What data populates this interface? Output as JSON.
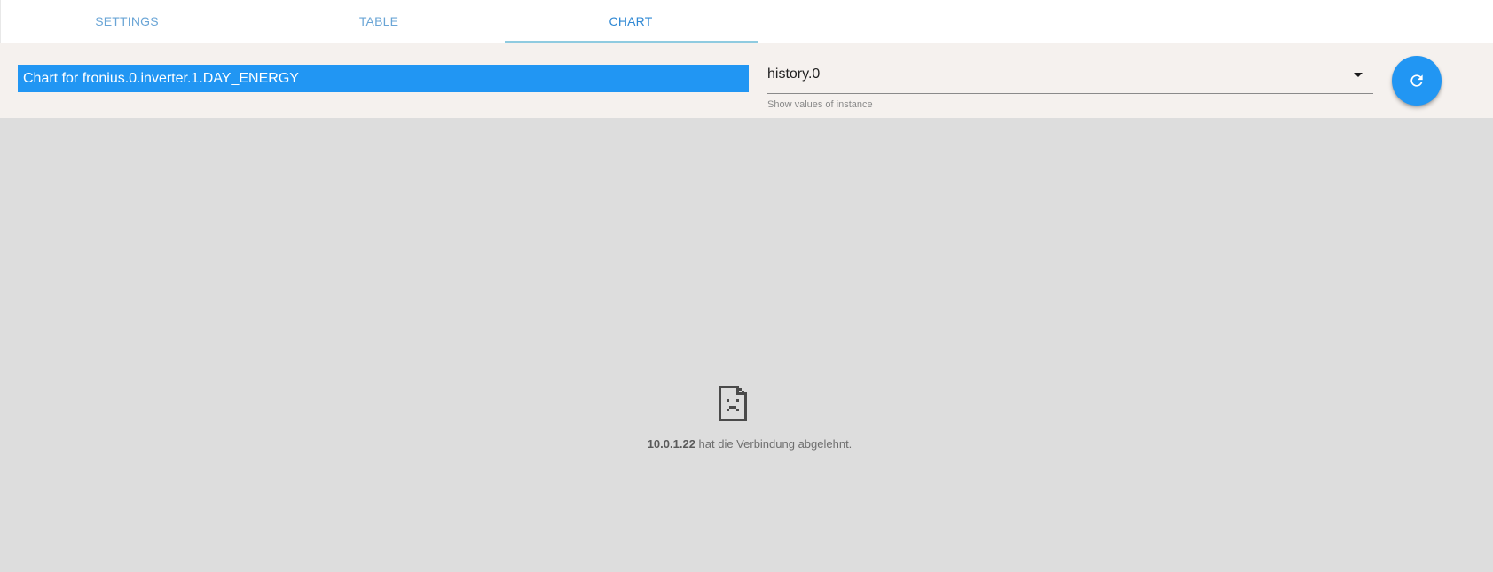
{
  "tabs": [
    {
      "label": "SETTINGS",
      "active": false
    },
    {
      "label": "TABLE",
      "active": false
    },
    {
      "label": "CHART",
      "active": true
    }
  ],
  "toolbar": {
    "title": "Chart for fronius.0.inverter.1.DAY_ENERGY",
    "instance_select": {
      "value": "history.0",
      "helper": "Show values of instance"
    },
    "refresh_icon": "refresh-icon"
  },
  "error": {
    "icon": "broken-page-icon",
    "host": "10.0.1.22",
    "message": " hat die Verbindung abgelehnt."
  },
  "colors": {
    "accent": "#2196f3",
    "toolbar_bg": "#f5f1ee",
    "content_bg": "#dddddd"
  }
}
